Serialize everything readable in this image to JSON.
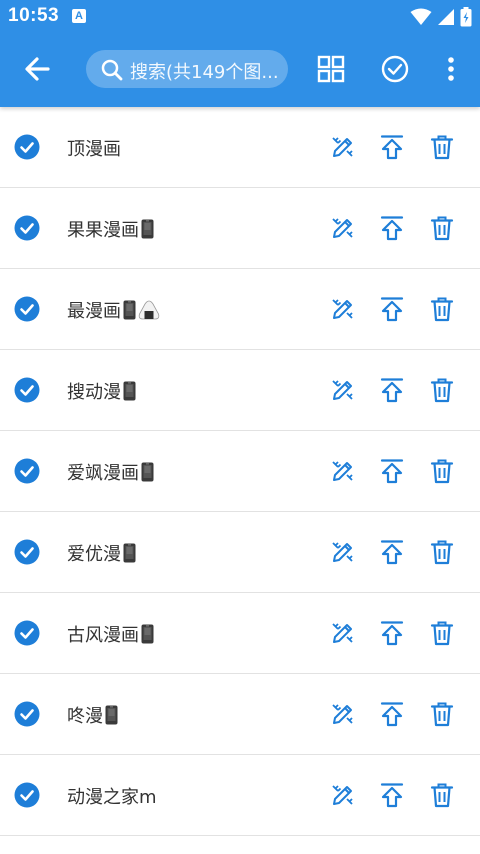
{
  "status_bar": {
    "time": "10:53",
    "app_indicator": "A",
    "icons": [
      "wifi-icon",
      "signal-icon",
      "battery-icon"
    ]
  },
  "toolbar": {
    "back_icon": "arrow-left-icon",
    "search_placeholder": "搜索(共149个图...",
    "grid_icon": "grid-icon",
    "select_all_icon": "check-circle-icon",
    "more_icon": "more-vert-icon"
  },
  "colors": {
    "primary": "#2f8fe6",
    "accent": "#1e7ed8",
    "text": "#333333",
    "divider": "#e2e2e2"
  },
  "items": [
    {
      "name": "顶漫画",
      "emoji": []
    },
    {
      "name": "果果漫画",
      "emoji": [
        "phone"
      ]
    },
    {
      "name": "最漫画",
      "emoji": [
        "phone",
        "onigiri"
      ]
    },
    {
      "name": "搜动漫",
      "emoji": [
        "phone"
      ]
    },
    {
      "name": "爱飒漫画",
      "emoji": [
        "phone"
      ]
    },
    {
      "name": "爱优漫",
      "emoji": [
        "phone"
      ]
    },
    {
      "name": "古风漫画",
      "emoji": [
        "phone"
      ]
    },
    {
      "name": "咚漫",
      "emoji": [
        "phone"
      ]
    },
    {
      "name": "动漫之家m",
      "emoji": []
    }
  ],
  "row_actions": [
    "edit-icon",
    "upload-icon",
    "delete-icon"
  ]
}
